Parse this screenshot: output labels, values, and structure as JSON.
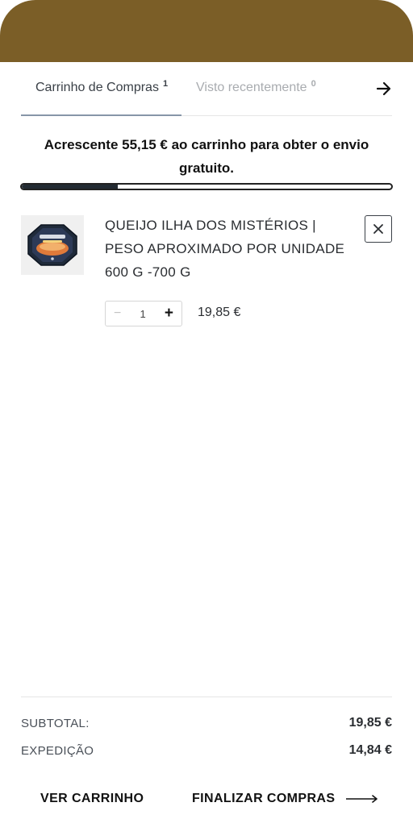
{
  "tabs": {
    "cart_label": "Carrinho de Compras",
    "cart_count": "1",
    "recent_label": "Visto recentemente",
    "recent_count": "0",
    "next_icon": "arrow-right-icon"
  },
  "shipping": {
    "message": "Acrescente 55,15 € ao carrinho para obter o envio gratuito.",
    "progress_fraction": 0.26
  },
  "cart_item": {
    "title": "QUEIJO ILHA DOS MISTÉRIOS | PESO APROXIMADO POR UNIDADE 600 G -700 G",
    "quantity": "1",
    "price": "19,85 €",
    "remove_icon": "close-icon",
    "minus_symbol": "−",
    "plus_symbol": "+"
  },
  "summary": {
    "subtotal_label": "SUBTOTAL:",
    "subtotal_value": "19,85 €",
    "shipping_label": "EXPEDIÇÃO",
    "shipping_value": "14,84 €"
  },
  "actions": {
    "view_cart_label": "VER CARRINHO",
    "checkout_label": "FINALIZAR COMPRAS",
    "checkout_icon": "long-arrow-right-icon"
  },
  "colors": {
    "header_band": "#7b5e27",
    "progress_fill": "#232b33"
  }
}
